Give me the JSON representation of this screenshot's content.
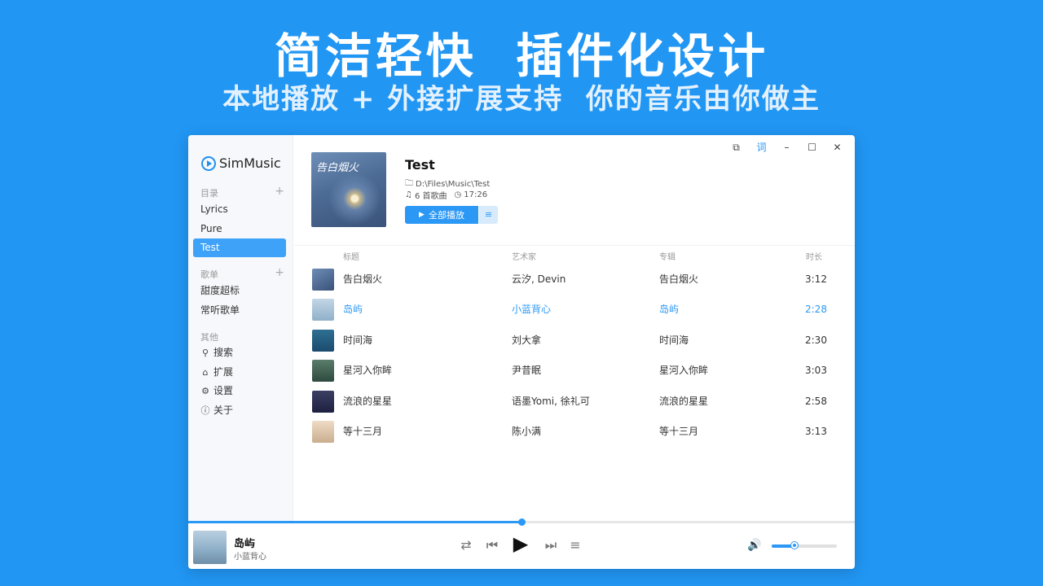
{
  "promo": {
    "headline": "简洁轻快  插件化设计",
    "subline": "本地播放 + 外接扩展支持  你的音乐由你做主"
  },
  "app": {
    "name": "SimMusic",
    "accent_color": "#2b98f5"
  },
  "titlebar": {
    "miniplayer_icon": "miniplayer-icon",
    "lyrics_label": "词",
    "minimize_label": "–",
    "maximize_label": "☐",
    "close_label": "✕"
  },
  "sidebar": {
    "directory_header": "目录",
    "directory_items": [
      {
        "label": "Lyrics",
        "active": false
      },
      {
        "label": "Pure",
        "active": false
      },
      {
        "label": "Test",
        "active": true
      }
    ],
    "playlist_header": "歌单",
    "playlist_items": [
      {
        "label": "甜度超标"
      },
      {
        "label": "常听歌单"
      }
    ],
    "other_header": "其他",
    "other_items": [
      {
        "label": "搜索",
        "icon": "search-icon"
      },
      {
        "label": "扩展",
        "icon": "extension-icon"
      },
      {
        "label": "设置",
        "icon": "settings-icon"
      },
      {
        "label": "关于",
        "icon": "info-icon"
      }
    ]
  },
  "album": {
    "title": "Test",
    "cover_text": "告白烟火",
    "path": "D:\\Files\\Music\\Test",
    "song_count": "6 首歌曲",
    "duration": "17:26",
    "play_all_label": "全部播放"
  },
  "table": {
    "headers": {
      "title": "标题",
      "artist": "艺术家",
      "album": "专辑",
      "duration": "时长"
    },
    "rows": [
      {
        "title": "告白烟火",
        "artist": "云汐, Devin",
        "album": "告白烟火",
        "duration": "3:12",
        "playing": false
      },
      {
        "title": "岛屿",
        "artist": "小蓝背心",
        "album": "岛屿",
        "duration": "2:28",
        "playing": true
      },
      {
        "title": "时间海",
        "artist": "刘大拿",
        "album": "时间海",
        "duration": "2:30",
        "playing": false
      },
      {
        "title": "星河入你眸",
        "artist": "尹昔眠",
        "album": "星河入你眸",
        "duration": "3:03",
        "playing": false
      },
      {
        "title": "流浪的星星",
        "artist": "语墨Yomi, 徐礼可",
        "album": "流浪的星星",
        "duration": "2:58",
        "playing": false
      },
      {
        "title": "等十三月",
        "artist": "陈小满",
        "album": "等十三月",
        "duration": "3:13",
        "playing": false
      }
    ]
  },
  "player": {
    "title": "岛屿",
    "artist": "小蓝背心",
    "progress": 0.5,
    "volume": 0.35,
    "controls": [
      "shuffle-icon",
      "previous-icon",
      "play-icon",
      "next-icon",
      "playlist-icon"
    ]
  }
}
